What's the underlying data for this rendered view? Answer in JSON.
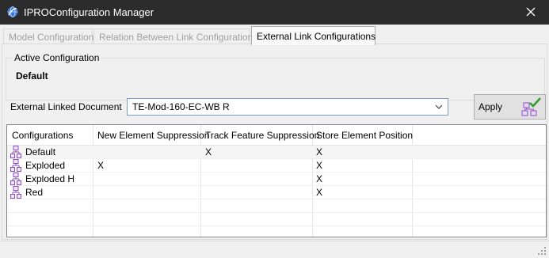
{
  "window": {
    "title": "IPROConfiguration Manager",
    "app_icon": "ipro-globe-icon",
    "close_icon": "close-icon"
  },
  "tabs": [
    {
      "label": "Model Configuration",
      "active": false
    },
    {
      "label": "Relation Between Link Configurations",
      "active": false
    },
    {
      "label": "External Link Configurations",
      "active": true
    }
  ],
  "active_configuration": {
    "legend": "Active Configuration",
    "value": "Default"
  },
  "external_doc": {
    "label": "External Linked Document",
    "selected": "TE-Mod-160-EC-WB R"
  },
  "apply_button": {
    "label": "Apply",
    "icon": "apply-checkmark-icon"
  },
  "grid": {
    "headers": [
      "Configurations",
      "New Element Suppression",
      "Track Feature Suppression",
      "Store Element Position"
    ],
    "rows": [
      {
        "name": "Default",
        "new_elem": "",
        "track_feat": "X",
        "store_pos": "X"
      },
      {
        "name": "Exploded",
        "new_elem": "X",
        "track_feat": "",
        "store_pos": "X"
      },
      {
        "name": "Exploded H",
        "new_elem": "",
        "track_feat": "",
        "store_pos": "X"
      },
      {
        "name": "Red",
        "new_elem": "",
        "track_feat": "",
        "store_pos": "X"
      }
    ],
    "row_icon": "configuration-tree-icon"
  },
  "colors": {
    "titlebar": "#2b2b2b",
    "combo_border": "#7a9ec9",
    "icon_purple": "#8a4fc4"
  }
}
